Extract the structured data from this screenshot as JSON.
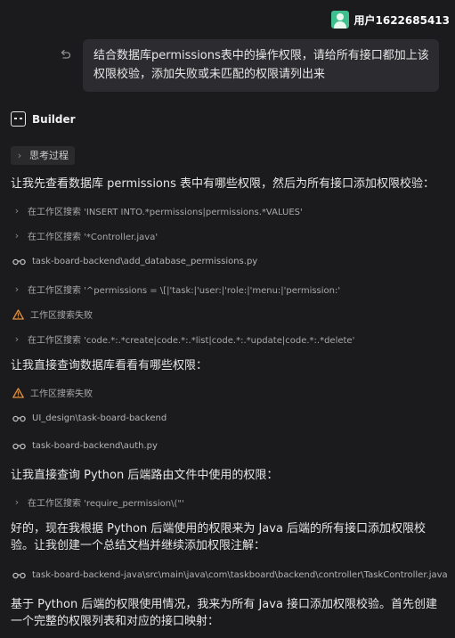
{
  "user": {
    "name": "用户1622685413",
    "message": "结合数据库permissions表中的操作权限，请给所有接口都加上该权限校验，添加失败或未匹配的权限请列出来"
  },
  "assistant": {
    "name": "Builder",
    "think_label": "思考过程",
    "p1": "让我先查看数据库 permissions 表中有哪些权限，然后为所有接口添加权限校验：",
    "steps1": [
      "在工作区搜索 'INSERT INTO.*permissions|permissions.*VALUES'",
      "在工作区搜索 '*Controller.java'",
      "task-board-backend\\add_database_permissions.py",
      "在工作区搜索 '^permissions = \\[|'task:|'user:|'role:|'menu:|'permission:'",
      "工作区搜索失败",
      "在工作区搜索 'code.*:.*create|code.*:.*list|code.*:.*update|code.*:.*delete'"
    ],
    "p2": "让我直接查询数据库看看有哪些权限：",
    "steps2": [
      "工作区搜索失败",
      "UI_design\\task-board-backend",
      "task-board-backend\\auth.py"
    ],
    "p3": "让我直接查询 Python 后端路由文件中使用的权限：",
    "steps3": [
      "在工作区搜索 'require_permission\\(\"'"
    ],
    "p4": "好的，现在我根据 Python 后端使用的权限来为 Java 后端的所有接口添加权限校验。让我创建一个总结文档并继续添加权限注解：",
    "steps4": [
      "task-board-backend-java\\src\\main\\java\\com\\taskboard\\backend\\controller\\TaskController.java"
    ],
    "p5": "基于 Python 后端的权限使用情况，我来为所有 Java 接口添加权限校验。首先创建一个完整的权限列表和对应的接口映射："
  },
  "colors": {
    "background": "#1b1b1d",
    "bubble": "#2c2c30",
    "avatar": "#3fbf8f",
    "warning": "#e2903c"
  }
}
